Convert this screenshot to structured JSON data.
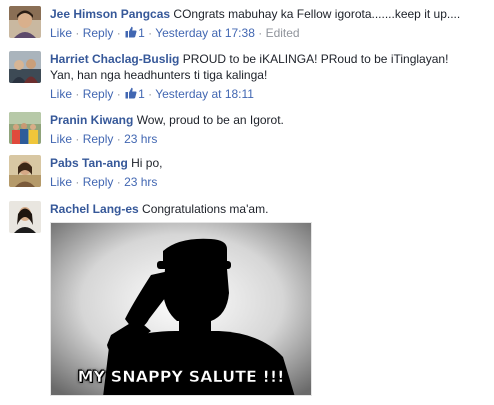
{
  "comments": [
    {
      "author": "Jee Himson Pangcas",
      "text": "COngrats mabuhay ka Fellow igorota.......keep it up....",
      "like_label": "Like",
      "reply_label": "Reply",
      "like_count": "1",
      "time": "Yesterday at 17:38",
      "edited": "Edited"
    },
    {
      "author": "Harriet Chaclag-Buslig",
      "text_line1": "PROUD to be iKALINGA! PRoud to be iTinglayan!",
      "text_line2": "Yan, han nga headhunters ti tiga kalinga!",
      "like_label": "Like",
      "reply_label": "Reply",
      "like_count": "1",
      "time": "Yesterday at 18:11"
    },
    {
      "author": "Pranin Kiwang",
      "text": "Wow, proud to be an Igorot.",
      "like_label": "Like",
      "reply_label": "Reply",
      "time": "23 hrs"
    },
    {
      "author": "Pabs Tan-ang",
      "text": "Hi po,",
      "like_label": "Like",
      "reply_label": "Reply",
      "time": "23 hrs"
    },
    {
      "author": "Rachel Lang-es",
      "text": "Congratulations ma'am.",
      "image_caption": "MY SNAPPY SALUTE !!!"
    }
  ],
  "separator": "·",
  "icons": {
    "like": "thumbs-up-icon"
  },
  "colors": {
    "author_link": "#365899",
    "action_link": "#4267b2",
    "meta_text": "#90949c",
    "body_text": "#1d2129"
  }
}
